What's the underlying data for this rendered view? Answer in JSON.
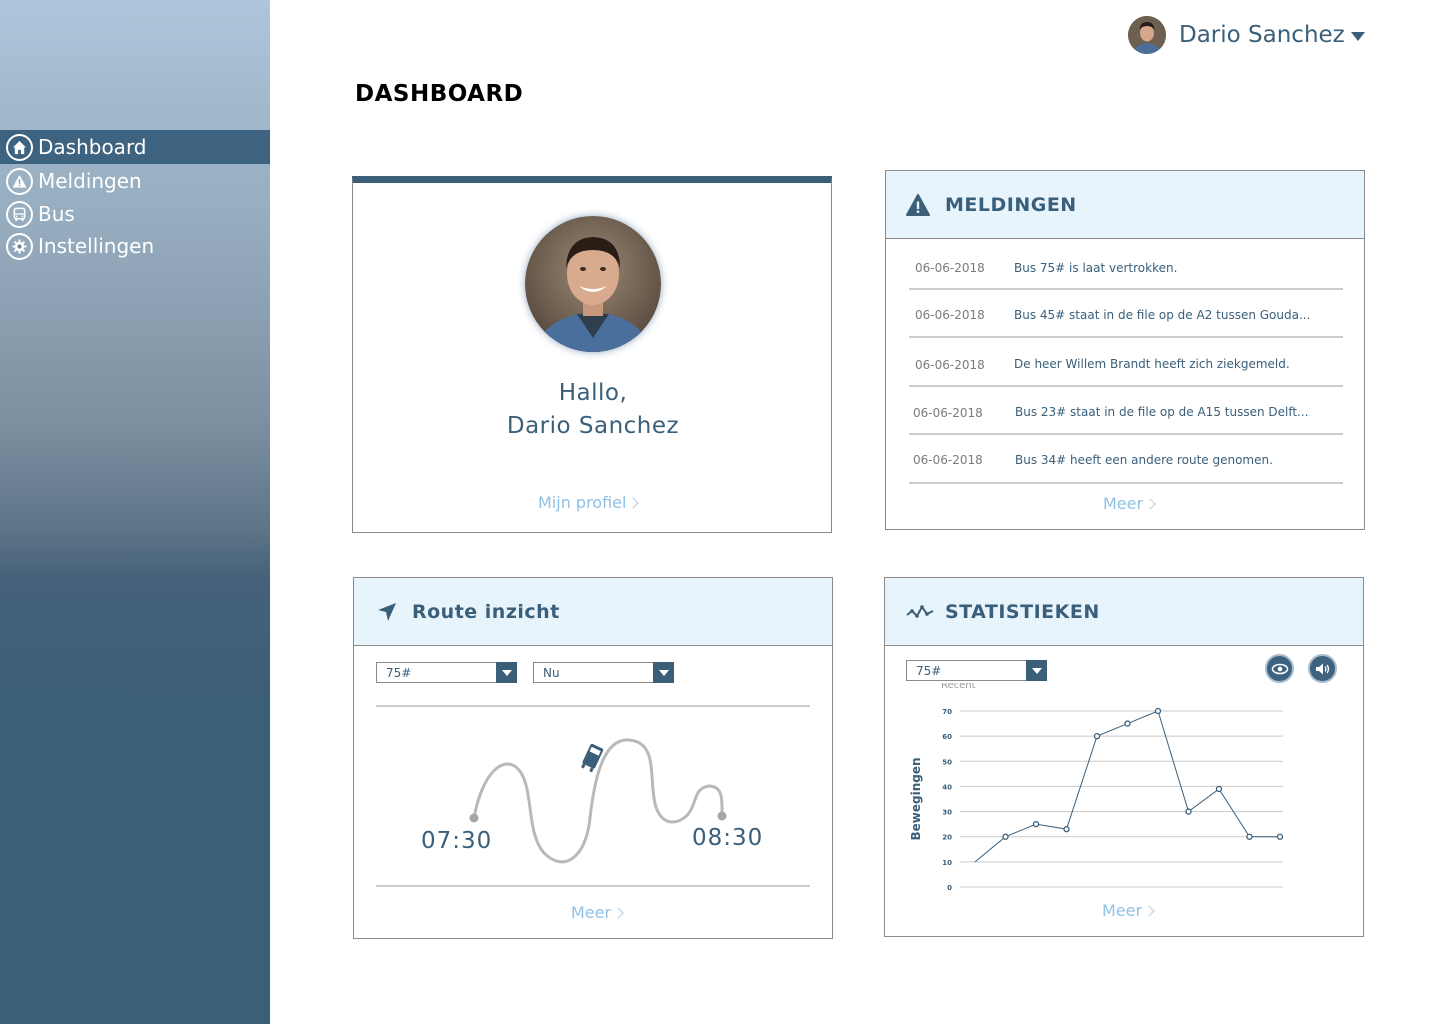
{
  "sidebar": {
    "items": [
      {
        "label": "Dashboard",
        "icon": "home-icon",
        "active": true
      },
      {
        "label": "Meldingen",
        "icon": "warning-icon",
        "active": false
      },
      {
        "label": "Bus",
        "icon": "bus-icon",
        "active": false
      },
      {
        "label": "Instellingen",
        "icon": "gear-icon",
        "active": false
      }
    ]
  },
  "header": {
    "user_name": "Dario Sanchez",
    "page_title": "DASHBOARD"
  },
  "profile": {
    "greeting": "Hallo,",
    "name": "Dario Sanchez",
    "link": "Mijn profiel"
  },
  "meldingen": {
    "title": "MELDINGEN",
    "items": [
      {
        "date": "06-06-2018",
        "text": "Bus 75# is laat vertrokken."
      },
      {
        "date": "06-06-2018",
        "text": "Bus 45# staat in de file op de A2 tussen Gouda..."
      },
      {
        "date": "06-06-2018",
        "text": "De heer Willem Brandt heeft zich ziekgemeld."
      },
      {
        "date": "06-06-2018",
        "text": "Bus 23# staat in de file op de A15 tussen Delft..."
      },
      {
        "date": "06-06-2018",
        "text": "Bus 34# heeft een andere route genomen."
      }
    ],
    "more": "Meer"
  },
  "route": {
    "title": "Route inzicht",
    "bus_select": "75#",
    "time_select": "Nu",
    "start_time": "07:30",
    "end_time": "08:30",
    "more": "Meer"
  },
  "stats": {
    "title": "STATISTIEKEN",
    "bus_select": "75#",
    "more": "Meer"
  },
  "chart_data": {
    "type": "line",
    "title": "Recent",
    "ylabel": "Bewegingen",
    "xlabel": "",
    "ylim": [
      0,
      70
    ],
    "yticks": [
      0,
      10,
      20,
      30,
      40,
      50,
      60,
      70
    ],
    "x": [
      1,
      2,
      3,
      4,
      5,
      6,
      7,
      8,
      9,
      10,
      11
    ],
    "values": [
      20,
      25,
      23,
      60,
      65,
      70,
      30,
      39,
      20,
      20
    ],
    "start_value": 10,
    "grid": true
  },
  "colors": {
    "primary": "#3b5e79",
    "header_bg": "#e8f4fc",
    "link": "#8fc2e6"
  }
}
